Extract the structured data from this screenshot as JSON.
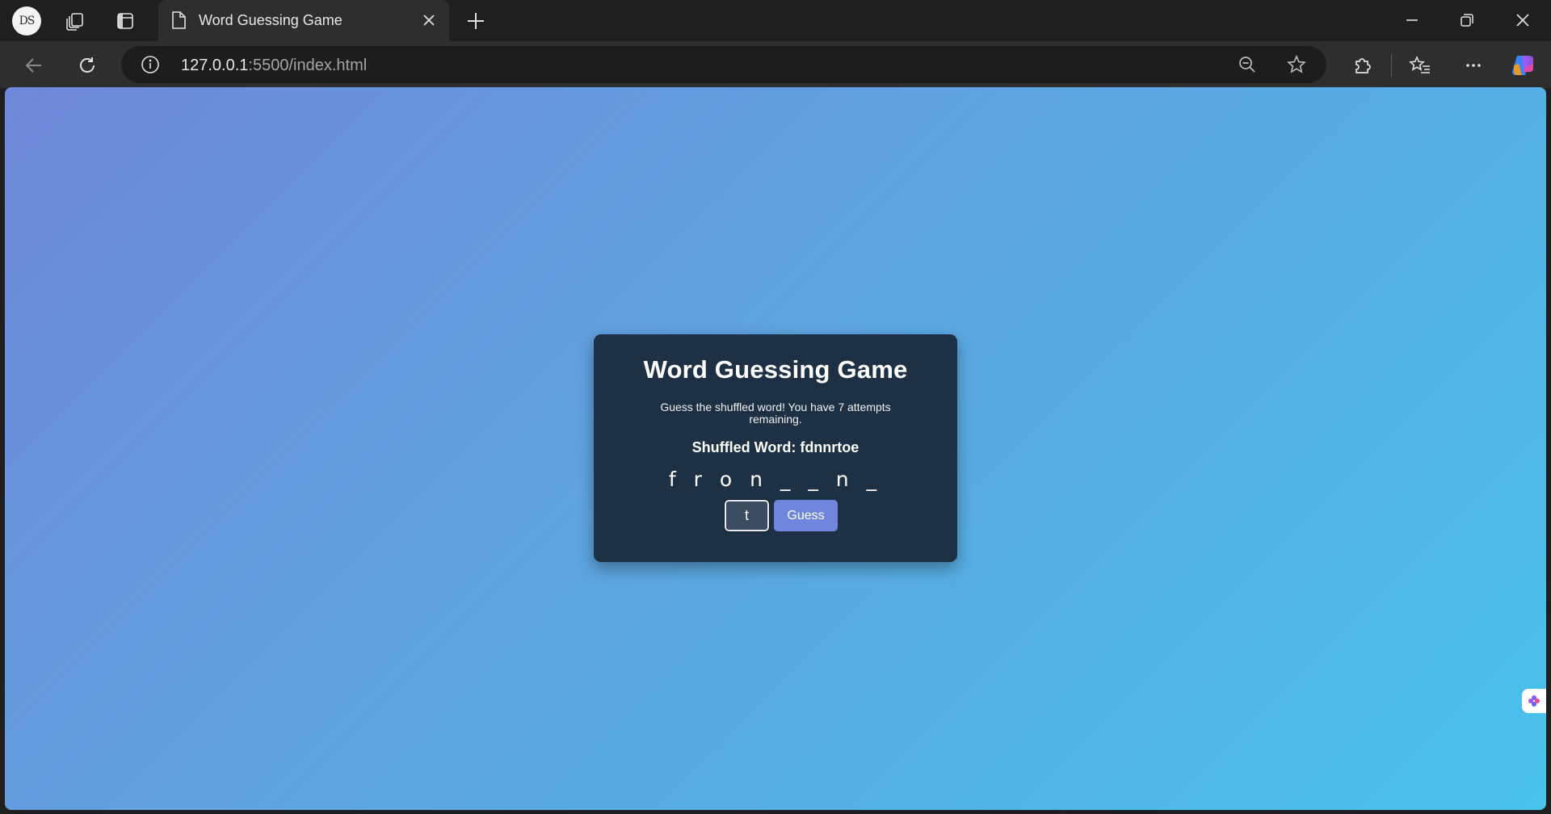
{
  "browser": {
    "profile_initials": "DS",
    "tab_title": "Word Guessing Game",
    "url_host": "127.0.0.1",
    "url_rest": ":5500/index.html"
  },
  "game": {
    "title": "Word Guessing Game",
    "instructions": "Guess the shuffled word! You have 7 attempts remaining.",
    "shuffled_label": "Shuffled Word: fdnnrtoe",
    "progress": "f r o n _ _ n _",
    "input_value": "t",
    "guess_button": "Guess"
  },
  "colors": {
    "card_bg": "#1e3044",
    "button_bg": "#6f86dc",
    "gradient_start": "#7088d9",
    "gradient_end": "#49c2ec"
  }
}
